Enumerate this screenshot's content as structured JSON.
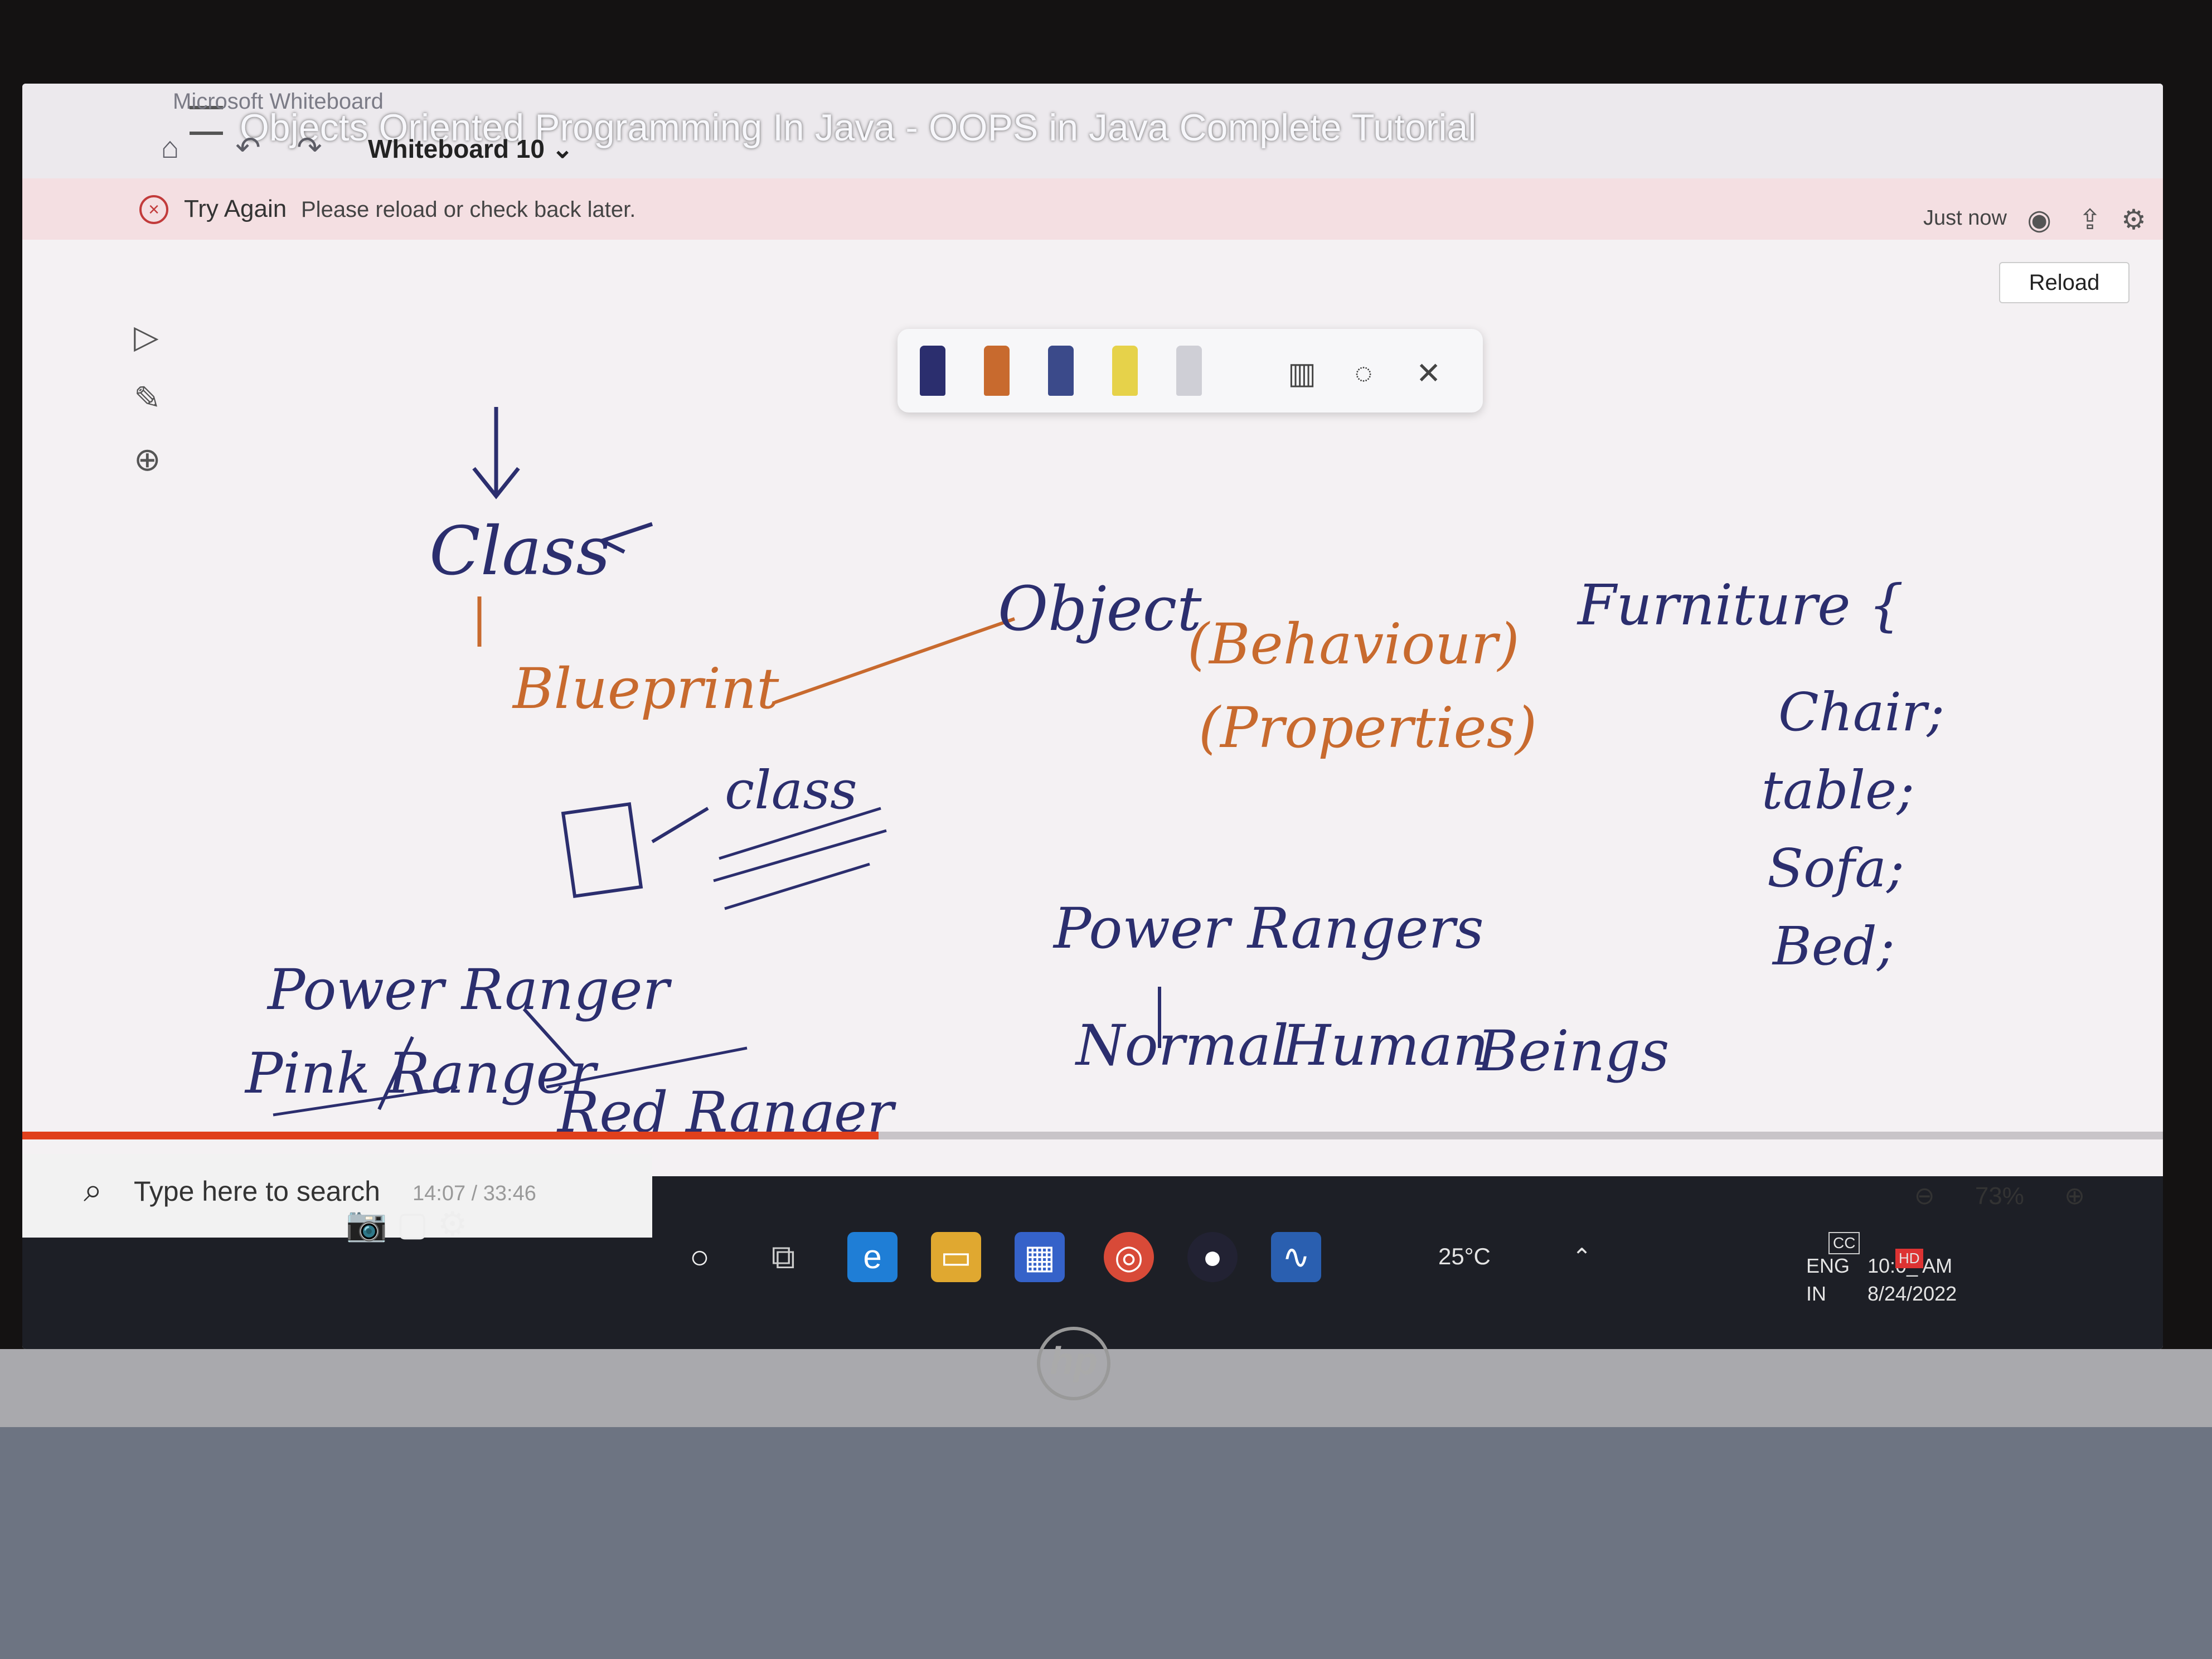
{
  "app": {
    "name": "Microsoft Whiteboard",
    "video_title": "Objects Oriented Programming In Java - OOPS in Java Complete Tutorial",
    "whiteboard_name": "Whiteboard 10"
  },
  "error": {
    "title": "Try Again",
    "message": "Please reload or check back later."
  },
  "status": {
    "saved": "Just now"
  },
  "reload_label": "Reload",
  "handwriting": {
    "class_top": "Class",
    "blueprint": "Blueprint",
    "object": "Object",
    "behaviour": "(Behaviour)",
    "properties": "(Properties)",
    "furniture": "Furniture {",
    "chair": "Chair;",
    "table": "table;",
    "sofa": "Sofa;",
    "bed": "Bed;",
    "class_mid": "class",
    "power_ranger_left": "Power Ranger",
    "pink_ranger": "Pink Ranger",
    "red_ranger": "Red Ranger",
    "power_rangers_right": "Power Rangers",
    "normal": "Normal",
    "human": "Human",
    "beings": "Beings"
  },
  "player": {
    "progress": 0.4,
    "time": "14:07 / 33:46"
  },
  "taskbar": {
    "search_placeholder": "Type here to search",
    "weather": "25°C",
    "language_top": "ENG",
    "language_bottom": "IN",
    "time": "10:0_ AM",
    "date": "8/24/2022",
    "hd_badge": "HD",
    "cc_badge": "CC"
  },
  "zoom": {
    "value": "73%"
  },
  "colors": {
    "ink_blue": "#2b2e6e",
    "ink_orange": "#c86a2e",
    "accent_red": "#e0401c",
    "error_bg": "#f4dfe2"
  },
  "brand": "hp"
}
